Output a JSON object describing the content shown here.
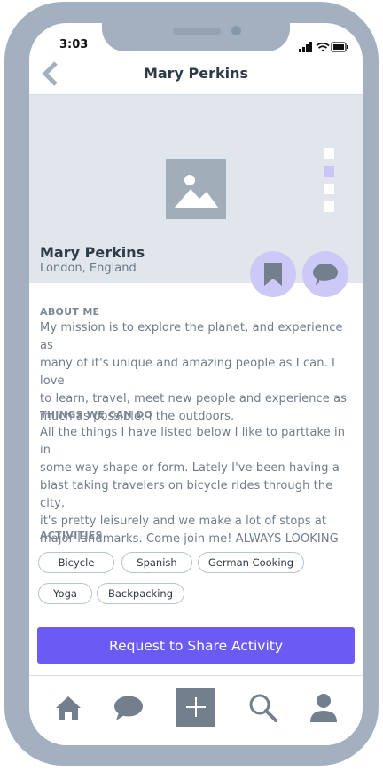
{
  "status_bar": {
    "time": "3:03"
  },
  "header": {
    "title": "Mary Perkins"
  },
  "profile": {
    "name": "Mary Perkins",
    "location": "London, England",
    "carousel_active_index": 1,
    "carousel_count": 4
  },
  "about": {
    "label": "ABOUT ME",
    "lines": [
      "My mission is to explore the planet, and experience as",
      "many of it's unique and amazing people as I can.  I love",
      "to learn, travel, meet new people and experience as",
      "much as possible. I the outdoors."
    ]
  },
  "things": {
    "label": "THINGS WE CAN DO",
    "lines": [
      "All the things I have listed below I like to parttake in in",
      "some way shape or form.  Lately I've been having a",
      "blast taking travelers on bicycle rides through the city,",
      "it's pretty leisurely and we make a lot of stops at",
      "major landmarks.  Come join me! ALWAYS LOOKING"
    ]
  },
  "activities": {
    "label": "ACTIVITIES",
    "items": [
      "Bicycle",
      "Spanish",
      "German Cooking",
      "Yoga",
      "Backpacking"
    ]
  },
  "cta": {
    "label": "Request to Share Activity"
  },
  "tabbar": {
    "icons": [
      "home-icon",
      "chat-icon",
      "add-icon",
      "search-icon",
      "profile-icon"
    ]
  },
  "colors": {
    "accent": "#6b5af4",
    "accent_light": "#cdc9f7",
    "frame": "#a3b0bf",
    "hero_bg": "#e1e6ed"
  }
}
